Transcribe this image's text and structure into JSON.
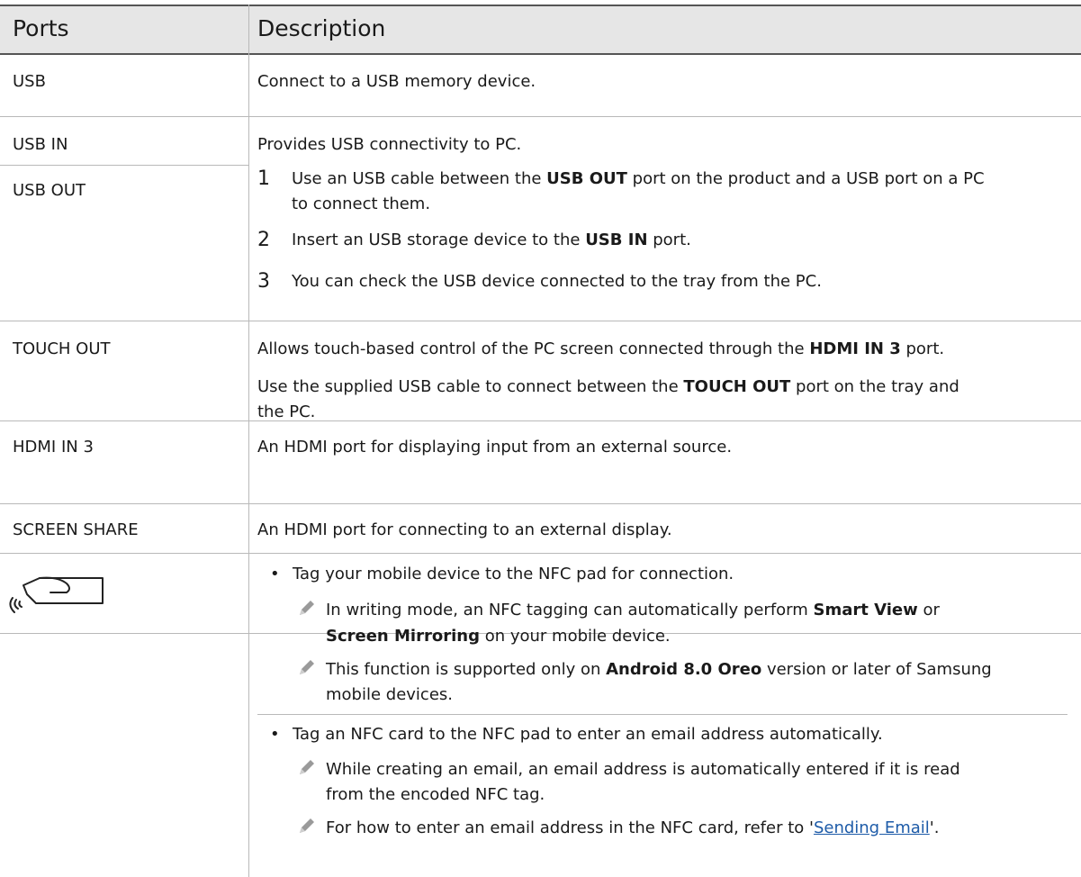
{
  "table": {
    "headers": {
      "ports": "Ports",
      "description": "Description"
    },
    "rows": {
      "usb": {
        "port": "USB",
        "desc": "Connect to a USB memory device."
      },
      "usbio": {
        "port1": "USB IN",
        "port2": "USB OUT",
        "intro": "Provides USB connectivity to PC.",
        "steps": [
          {
            "num": "1",
            "a": "Use an USB cable between the ",
            "b": "USB OUT",
            "c": " port on the product and a USB port on a PC",
            "d": "to connect them."
          },
          {
            "num": "2",
            "a": "Insert an USB storage device to the ",
            "b": "USB IN",
            "c": " port."
          },
          {
            "num": "3",
            "a": "You can check the USB device connected to the tray from the PC."
          }
        ]
      },
      "touch": {
        "port": "TOUCH OUT",
        "l1a": "Allows touch-based control of the PC screen connected through the ",
        "l1b": "HDMI IN 3",
        "l1c": " port.",
        "l2a": "Use the supplied USB cable to connect between the ",
        "l2b": "TOUCH OUT",
        "l2c": " port on the tray and",
        "l3": "the PC."
      },
      "hdmi": {
        "port": "HDMI IN 3",
        "desc": "An HDMI port for displaying input from an external source."
      },
      "share": {
        "port": "SCREEN SHARE",
        "desc": "An HDMI port for connecting to an external display."
      },
      "nfc": {
        "icon": "nfc-tag-icon",
        "b1": "Tag your mobile device to the NFC pad for connection.",
        "n1a": "In writing mode, an NFC tagging can automatically perform ",
        "n1b": "Smart View",
        "n1c": " or",
        "n1d": "Screen Mirroring",
        "n1e": " on your mobile device.",
        "n2a": "This function is supported only on ",
        "n2b": "Android 8.0 Oreo",
        "n2c": " version or later of Samsung",
        "n2d": "mobile devices.",
        "b2": "Tag an NFC card to the NFC pad to enter an email address automatically.",
        "n3a": "While creating an email, an email address is automatically entered if it is read",
        "n3b": "from the encoded NFC tag.",
        "n4a": "For how to enter an email address in the NFC card, refer to '",
        "n4link": "Sending Email",
        "n4b": "'."
      }
    }
  },
  "colors": {
    "header_bg": "#e6e6e6",
    "link": "#1d5ba8",
    "note_icon": "#9a9a9a"
  }
}
